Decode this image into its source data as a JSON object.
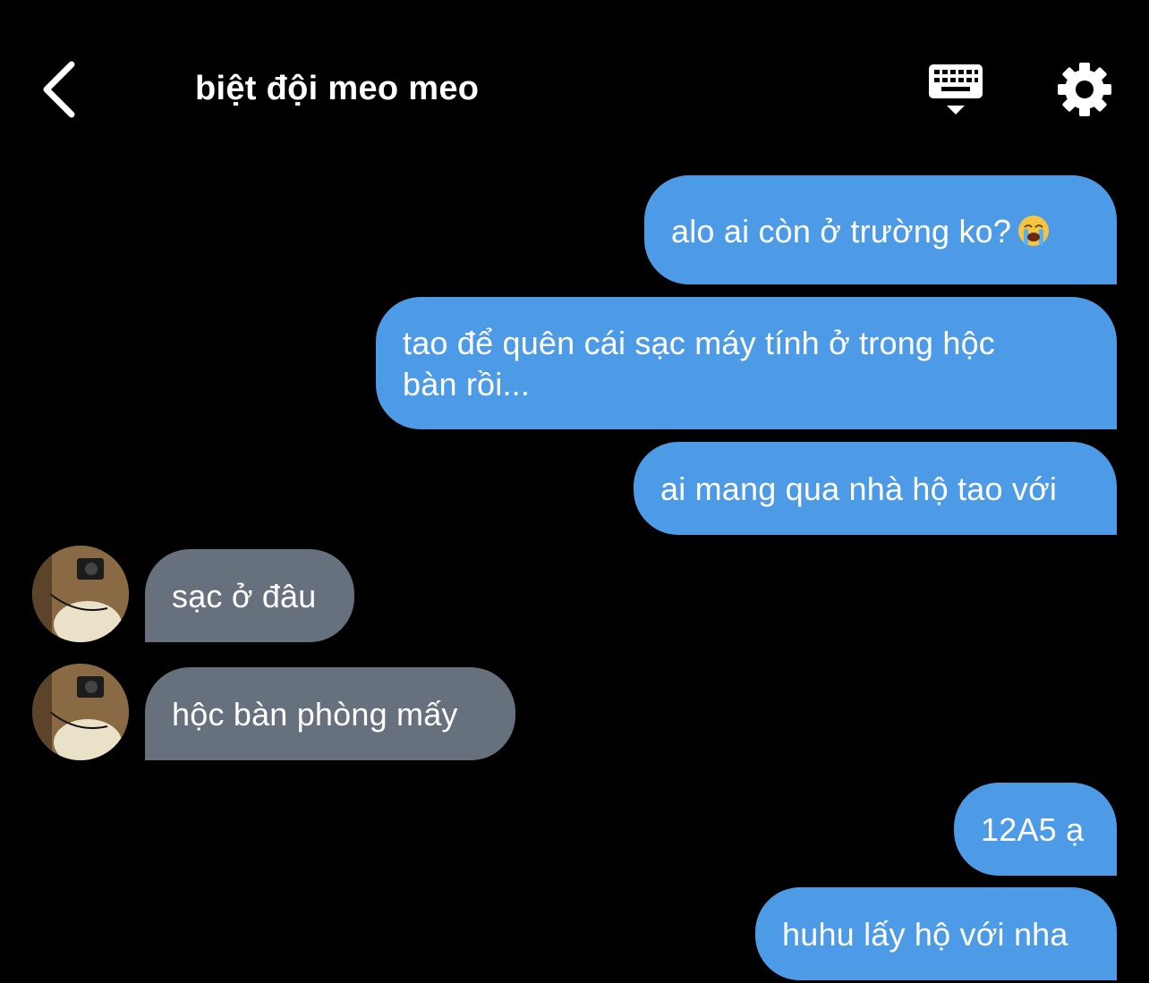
{
  "header": {
    "back_icon": "chevron-left-icon",
    "title": "biệt đội meo meo",
    "keyboard_icon": "keyboard-dismiss-icon",
    "settings_icon": "gear-icon"
  },
  "messages": [
    {
      "sender": "me",
      "text": "alo ai còn ở trường ko?",
      "emoji": "loudly-crying-face-icon"
    },
    {
      "sender": "me",
      "lines": [
        "tao để quên cái sạc máy tính ở trong hộc",
        "bàn rồi..."
      ]
    },
    {
      "sender": "me",
      "text": "ai mang qua nhà hộ tao với"
    },
    {
      "sender": "them",
      "text": "sạc ở đâu"
    },
    {
      "sender": "them",
      "text": "hộc bàn phòng mấy"
    },
    {
      "sender": "me",
      "text": "12A5 ạ"
    },
    {
      "sender": "me",
      "text": "huhu lấy hộ với nha"
    }
  ],
  "colors": {
    "background": "#000000",
    "my_bubble": "#4d9be6",
    "their_bubble": "#66717d",
    "text": "#ffffff"
  }
}
